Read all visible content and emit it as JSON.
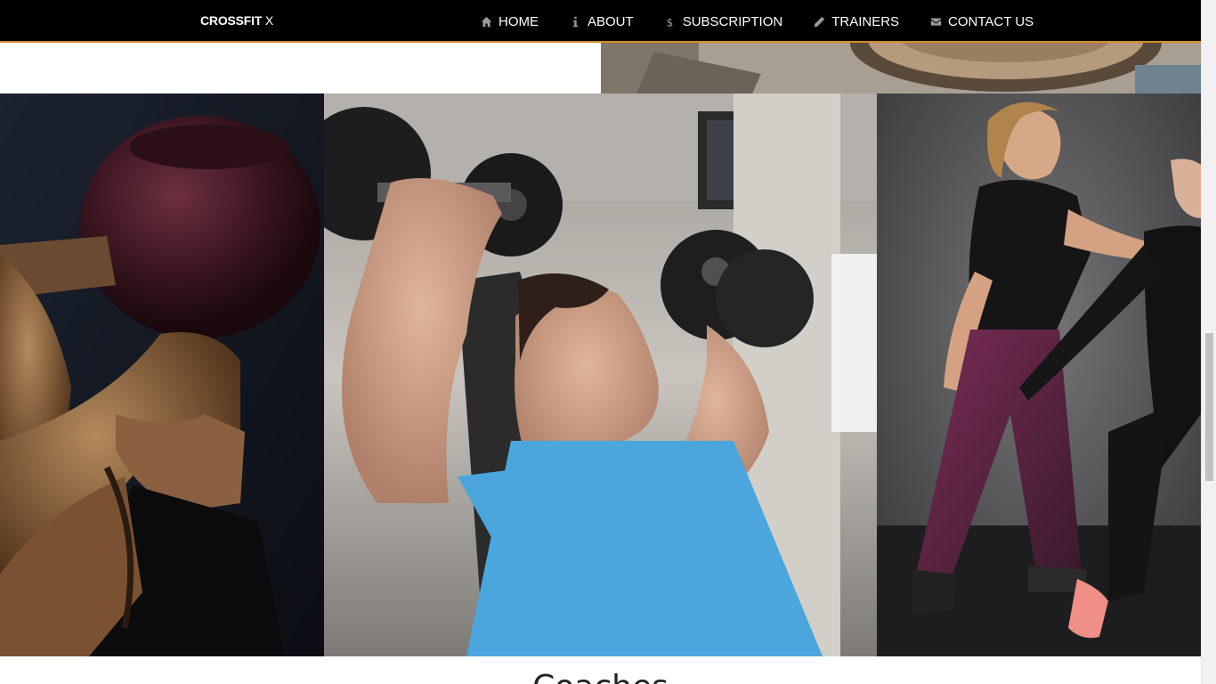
{
  "brand": {
    "name": "CROSSFIT",
    "suffix": "X"
  },
  "nav": {
    "items": [
      {
        "label": "HOME",
        "icon": "home-icon"
      },
      {
        "label": "ABOUT",
        "icon": "info-icon"
      },
      {
        "label": "SUBSCRIPTION",
        "icon": "dollar-icon"
      },
      {
        "label": "TRAINERS",
        "icon": "pencil-icon"
      },
      {
        "label": "CONTACT US",
        "icon": "envelope-icon"
      }
    ]
  },
  "gallery": {
    "photos": [
      {
        "subject": "man-lifting-kettlebell"
      },
      {
        "subject": "woman-dumbbell-press"
      },
      {
        "subject": "trainer-assisting-client"
      }
    ]
  },
  "section": {
    "heading": "Coaches"
  },
  "colors": {
    "nav_bg": "#000000",
    "nav_accent": "#d58a2e",
    "nav_text": "#ffffff"
  }
}
